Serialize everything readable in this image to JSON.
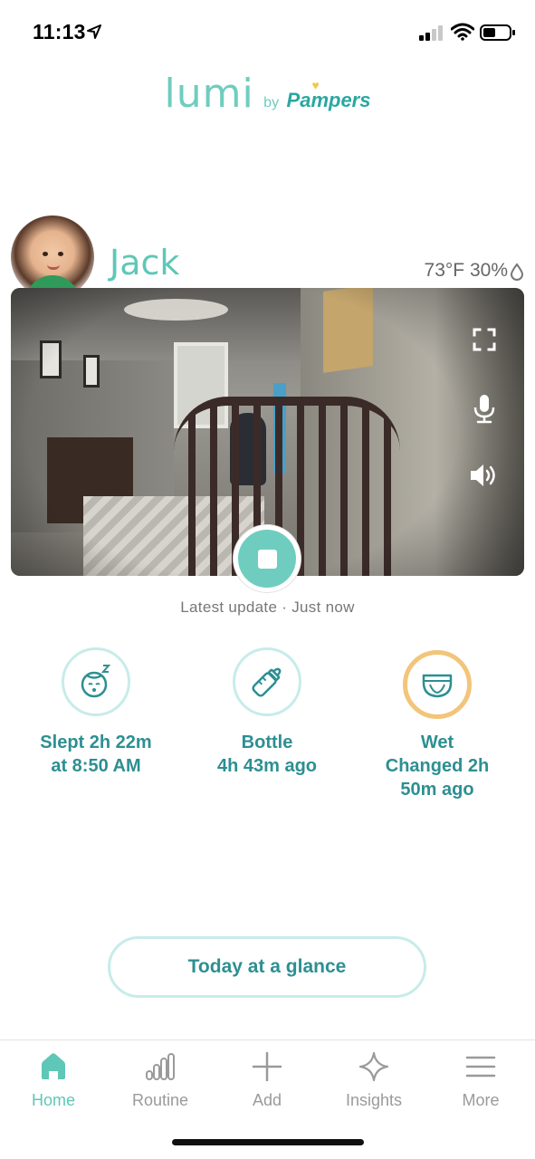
{
  "status_bar": {
    "time": "11:13"
  },
  "logo": {
    "brand": "lumi",
    "by": "by",
    "partner": "Pampers"
  },
  "baby": {
    "name": "Jack",
    "weather": "73°F 30%"
  },
  "camera": {
    "latest_update": "Latest update · Just now"
  },
  "stats": [
    {
      "icon": "sleeping-baby-icon",
      "line1": "Slept 2h 22m",
      "line2": "at 8:50 AM",
      "line3": ""
    },
    {
      "icon": "bottle-icon",
      "line1": "Bottle",
      "line2": "4h 43m ago",
      "line3": ""
    },
    {
      "icon": "diaper-icon",
      "line1": "Wet",
      "line2": "Changed 2h",
      "line3": "50m ago"
    }
  ],
  "glance_button": "Today at a glance",
  "tabs": [
    {
      "label": "Home",
      "icon": "home-icon",
      "active": true
    },
    {
      "label": "Routine",
      "icon": "routine-chart-icon",
      "active": false
    },
    {
      "label": "Add",
      "icon": "plus-icon",
      "active": false
    },
    {
      "label": "Insights",
      "icon": "sparkle-icon",
      "active": false
    },
    {
      "label": "More",
      "icon": "menu-icon",
      "active": false
    }
  ],
  "colors": {
    "accent": "#6fcdbf",
    "accent_dark": "#2d8f92",
    "highlight": "#f2c57a",
    "tab_inactive": "#9a9a9a"
  }
}
